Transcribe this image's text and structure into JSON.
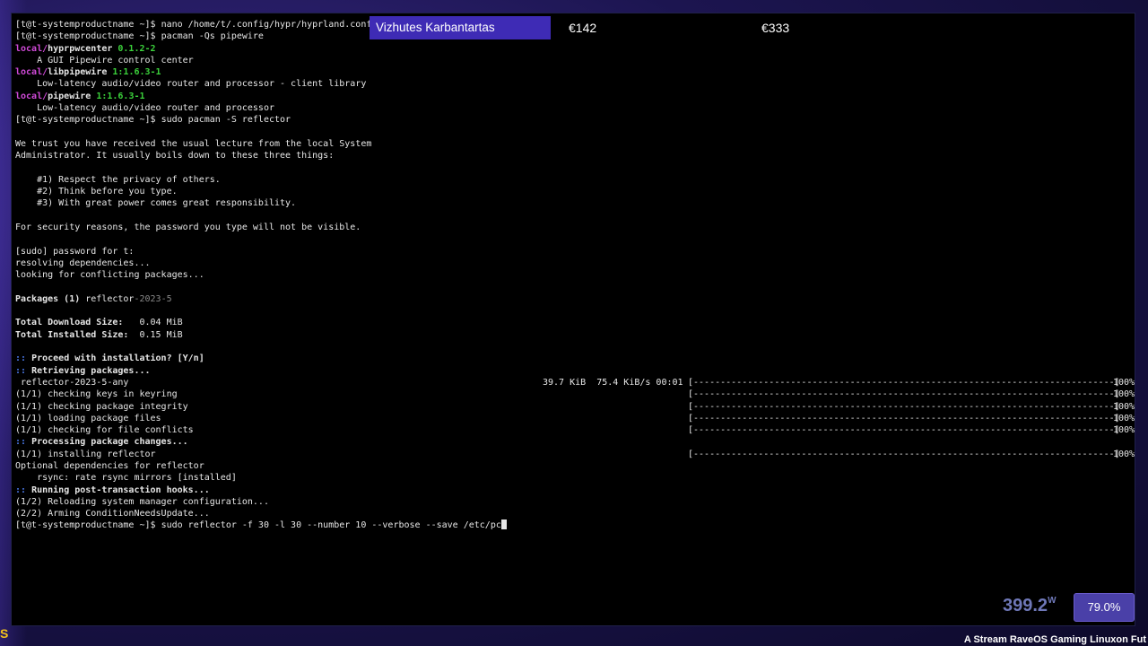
{
  "overlay": {
    "title": "Vizhutes Karbantartas",
    "price1": "€142",
    "price2": "€333"
  },
  "terminal": {
    "prompt": "[t@t-systemproductname ~]$",
    "l1_cmd": " nano /home/t/.config/hypr/hyprland.conf",
    "l2_cmd": " pacman -Qs pipewire",
    "pkg1_repo": "local/",
    "pkg1_name": "hyprpwcenter",
    "pkg1_ver": " 0.1.2-2",
    "pkg1_desc": "    A GUI Pipewire control center",
    "pkg2_repo": "local/",
    "pkg2_name": "libpipewire",
    "pkg2_ver": " 1:1.6.3-1",
    "pkg2_desc": "    Low-latency audio/video router and processor - client library",
    "pkg3_repo": "local/",
    "pkg3_name": "pipewire",
    "pkg3_ver": " 1:1.6.3-1",
    "pkg3_desc": "    Low-latency audio/video router and processor",
    "l3_cmd": " sudo pacman -S reflector",
    "lecture1": "We trust you have received the usual lecture from the local System",
    "lecture2": "Administrator. It usually boils down to these three things:",
    "rule1": "    #1) Respect the privacy of others.",
    "rule2": "    #2) Think before you type.",
    "rule3": "    #3) With great power comes great responsibility.",
    "security": "For security reasons, the password you type will not be visible.",
    "sudo_pw": "[sudo] password for t:",
    "resolving": "resolving dependencies...",
    "conflicts": "looking for conflicting packages...",
    "packages_label": "Packages (1)",
    "packages_name": " reflector",
    "packages_ver": "-2023-5",
    "dl_size_label": "Total Download Size:",
    "dl_size_value": "   0.04 MiB",
    "inst_size_label": "Total Installed Size:",
    "inst_size_value": "  0.15 MiB",
    "proceed_prefix": "::",
    "proceed": " Proceed with installation? [Y/n]",
    "retrieving_prefix": "::",
    "retrieving": " Retrieving packages...",
    "dl_file": " reflector-2023-5-any",
    "dl_stats": "39.7 KiB  75.4 KiB/s 00:01",
    "bar": "[------------------------------------------------------------------------------]",
    "pct": "100%",
    "step1": "(1/1) checking keys in keyring",
    "step2": "(1/1) checking package integrity",
    "step3": "(1/1) loading package files",
    "step4": "(1/1) checking for file conflicts",
    "processing_prefix": "::",
    "processing": " Processing package changes...",
    "step5": "(1/1) installing reflector",
    "optdeps": "Optional dependencies for reflector",
    "rsync": "    rsync: rate rsync mirrors [installed]",
    "hooks_prefix": "::",
    "hooks": " Running post-transaction hooks...",
    "hook1": "(1/2) Reloading system manager configuration...",
    "hook2": "(2/2) Arming ConditionNeedsUpdate...",
    "l4_cmd": " sudo reflector -f 30 -l 30 --number 10 --verbose --save /etc/pc"
  },
  "status": {
    "power": "399.2",
    "power_unit": "W",
    "battery": "79.0%",
    "marquee": "A Stream RaveOS Gaming Linuxon Fut",
    "corner_badge": "S"
  }
}
